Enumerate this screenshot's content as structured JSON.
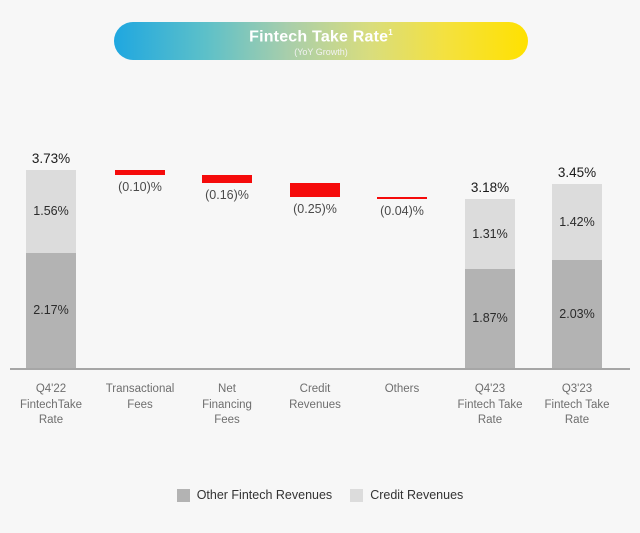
{
  "banner": {
    "title": "Fintech Take Rate",
    "title_superscript": "1",
    "subtitle": "(YoY Growth)",
    "gradient_start": "#1fa7e0",
    "gradient_end": "#ffe100"
  },
  "legend": {
    "items": [
      {
        "label": "Other Fintech Revenues",
        "color": "#b3b3b3",
        "icon": "square-swatch-icon"
      },
      {
        "label": "Credit Revenues",
        "color": "#dcdcdc",
        "icon": "square-swatch-icon"
      }
    ]
  },
  "colors": {
    "background": "#f7f7f7",
    "other_fintech_revenues": "#b3b3b3",
    "credit_revenues": "#dcdcdc",
    "delta_negative": "#f50b0b",
    "axis": "#a6a6a6"
  },
  "chart_data": {
    "type": "bar",
    "subtype": "waterfall-stacked",
    "title": "Fintech Take Rate",
    "subtitle": "(YoY Growth)",
    "xlabel": "",
    "ylabel": "",
    "unit": "%",
    "grid": false,
    "legend_position": "bottom-center",
    "categories": [
      "Q4'22 FintechTake Rate",
      "Transactional Fees",
      "Net Financing Fees",
      "Credit Revenues",
      "Others",
      "Q4'23 Fintech Take Rate",
      "Q3'23 Fintech Take Rate"
    ],
    "category_lines": [
      [
        "Q4'22",
        "FintechTake",
        "Rate"
      ],
      [
        "Transactional",
        "Fees"
      ],
      [
        "Net",
        "Financing",
        "Fees"
      ],
      [
        "Credit",
        "Revenues"
      ],
      [
        "Others"
      ],
      [
        "Q4'23",
        "Fintech Take",
        "Rate"
      ],
      [
        "Q3'23",
        "Fintech Take",
        "Rate"
      ]
    ],
    "bars": [
      {
        "kind": "total",
        "category": "Q4'22 FintechTake Rate",
        "total_label": "3.73%",
        "total_value": 3.73,
        "segments": [
          {
            "name": "Credit Revenues",
            "label": "1.56%",
            "value": 1.56
          },
          {
            "name": "Other Fintech Revenues",
            "label": "2.17%",
            "value": 2.17
          }
        ]
      },
      {
        "kind": "delta",
        "category": "Transactional Fees",
        "label": "(0.10)%",
        "value": -0.1
      },
      {
        "kind": "delta",
        "category": "Net Financing Fees",
        "label": "(0.16)%",
        "value": -0.16
      },
      {
        "kind": "delta",
        "category": "Credit Revenues",
        "label": "(0.25)%",
        "value": -0.25
      },
      {
        "kind": "delta",
        "category": "Others",
        "label": "(0.04)%",
        "value": -0.04
      },
      {
        "kind": "total",
        "category": "Q4'23 Fintech Take Rate",
        "total_label": "3.18%",
        "total_value": 3.18,
        "segments": [
          {
            "name": "Credit Revenues",
            "label": "1.31%",
            "value": 1.31
          },
          {
            "name": "Other Fintech Revenues",
            "label": "1.87%",
            "value": 1.87
          }
        ]
      },
      {
        "kind": "total",
        "category": "Q3'23 Fintech Take Rate",
        "total_label": "3.45%",
        "total_value": 3.45,
        "segments": [
          {
            "name": "Credit Revenues",
            "label": "1.42%",
            "value": 1.42
          },
          {
            "name": "Other Fintech Revenues",
            "label": "2.03%",
            "value": 2.03
          }
        ]
      }
    ]
  }
}
